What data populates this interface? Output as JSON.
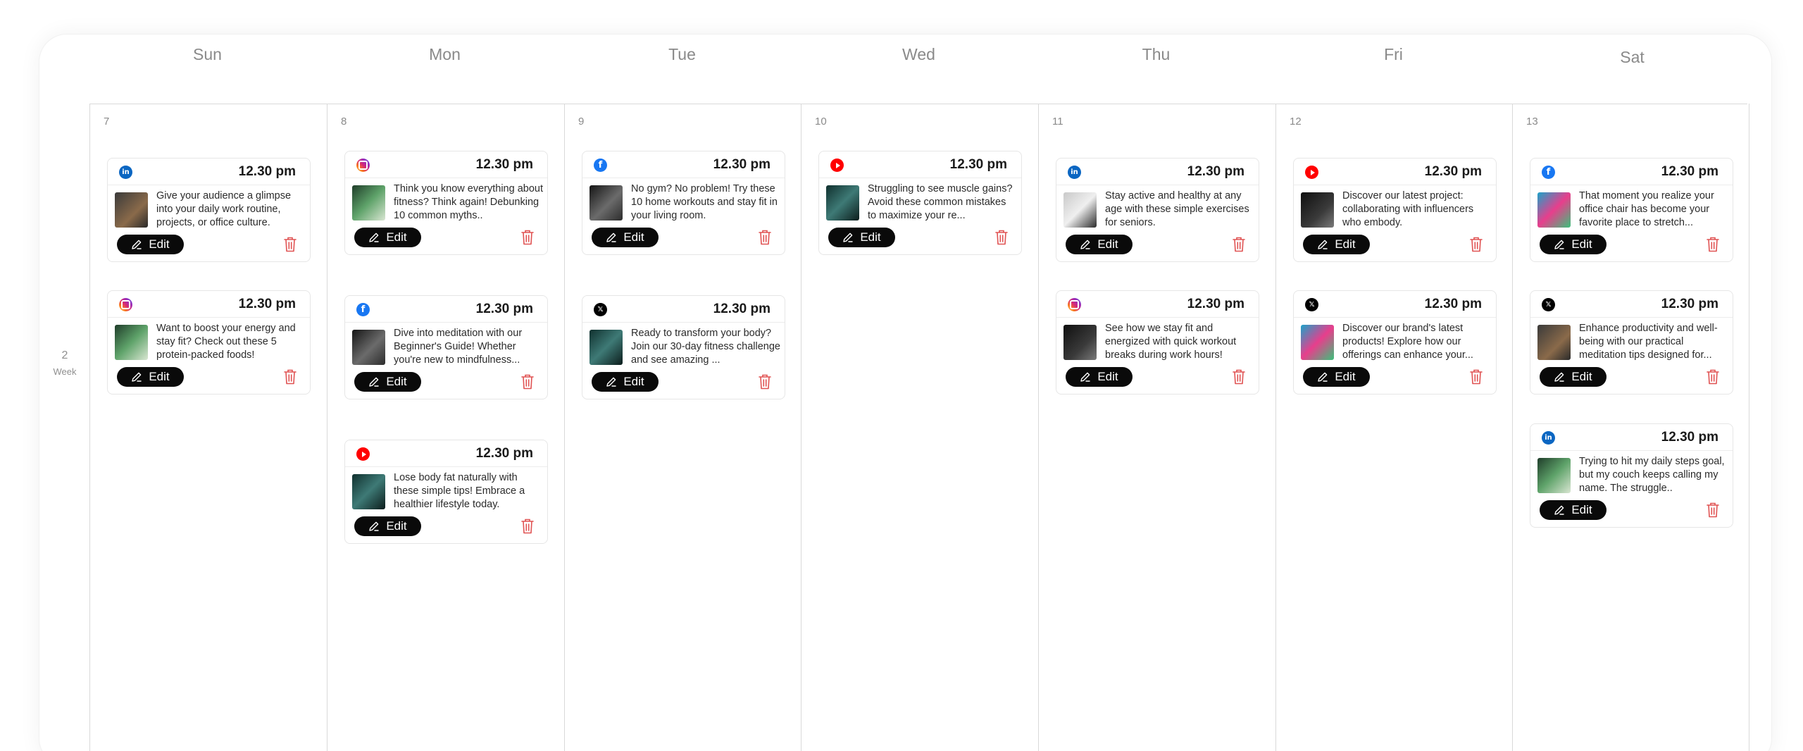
{
  "day_headers": [
    "Sun",
    "Mon",
    "Tue",
    "Wed",
    "Thu",
    "Fri",
    "Sat"
  ],
  "week": {
    "number": "2",
    "label": "Week"
  },
  "edit_label": "Edit",
  "days": [
    {
      "date": "7",
      "posts": [
        {
          "network": "linkedin",
          "time": "12.30 pm",
          "caption": "Give your audience a glimpse into your daily work routine, projects, or office culture."
        },
        {
          "network": "instagram",
          "time": "12.30 pm",
          "caption": "Want to boost your energy and stay fit? Check out these 5 protein-packed foods!"
        }
      ]
    },
    {
      "date": "8",
      "posts": [
        {
          "network": "instagram",
          "time": "12.30 pm",
          "caption": "Think you know everything about fitness? Think again! Debunking 10 common myths.."
        },
        {
          "network": "facebook",
          "time": "12.30 pm",
          "caption": "Dive into meditation with our Beginner's Guide! Whether you're new to mindfulness..."
        },
        {
          "network": "youtube",
          "time": "12.30 pm",
          "caption": "Lose body fat naturally with these simple tips! Embrace a healthier lifestyle today."
        }
      ]
    },
    {
      "date": "9",
      "posts": [
        {
          "network": "facebook",
          "time": "12.30 pm",
          "caption": "No gym? No problem! Try these 10 home workouts and stay fit in your living room."
        },
        {
          "network": "x",
          "time": "12.30 pm",
          "caption": "Ready to transform your body? Join our 30-day fitness challenge and see amazing ..."
        }
      ]
    },
    {
      "date": "10",
      "posts": [
        {
          "network": "youtube",
          "time": "12.30 pm",
          "caption": "Struggling to see muscle gains? Avoid these common mistakes to maximize your re..."
        }
      ]
    },
    {
      "date": "11",
      "posts": [
        {
          "network": "linkedin",
          "time": "12.30 pm",
          "caption": "Stay active and healthy at any age with these simple exercises for seniors."
        },
        {
          "network": "instagram",
          "time": "12.30 pm",
          "caption": "See how we stay fit and energized with quick workout breaks during work hours!"
        }
      ]
    },
    {
      "date": "12",
      "posts": [
        {
          "network": "youtube",
          "time": "12.30 pm",
          "caption": "Discover our latest project: collaborating with influencers who embody."
        },
        {
          "network": "x",
          "time": "12.30 pm",
          "caption": "Discover our brand's latest products! Explore how our offerings can enhance your..."
        }
      ]
    },
    {
      "date": "13",
      "posts": [
        {
          "network": "facebook",
          "time": "12.30 pm",
          "caption": "That moment you realize your office chair has become your favorite place to stretch..."
        },
        {
          "network": "x",
          "time": "12.30 pm",
          "caption": "Enhance productivity and well-being with our practical meditation tips designed for..."
        },
        {
          "network": "linkedin",
          "time": "12.30 pm",
          "caption": "Trying to hit my daily steps goal, but my couch keeps calling my name. The struggle.."
        }
      ]
    }
  ],
  "colors": {
    "accent_dark": "#0a0a0a",
    "delete_red": "#e05252",
    "grid_line": "#d9d9d9"
  }
}
